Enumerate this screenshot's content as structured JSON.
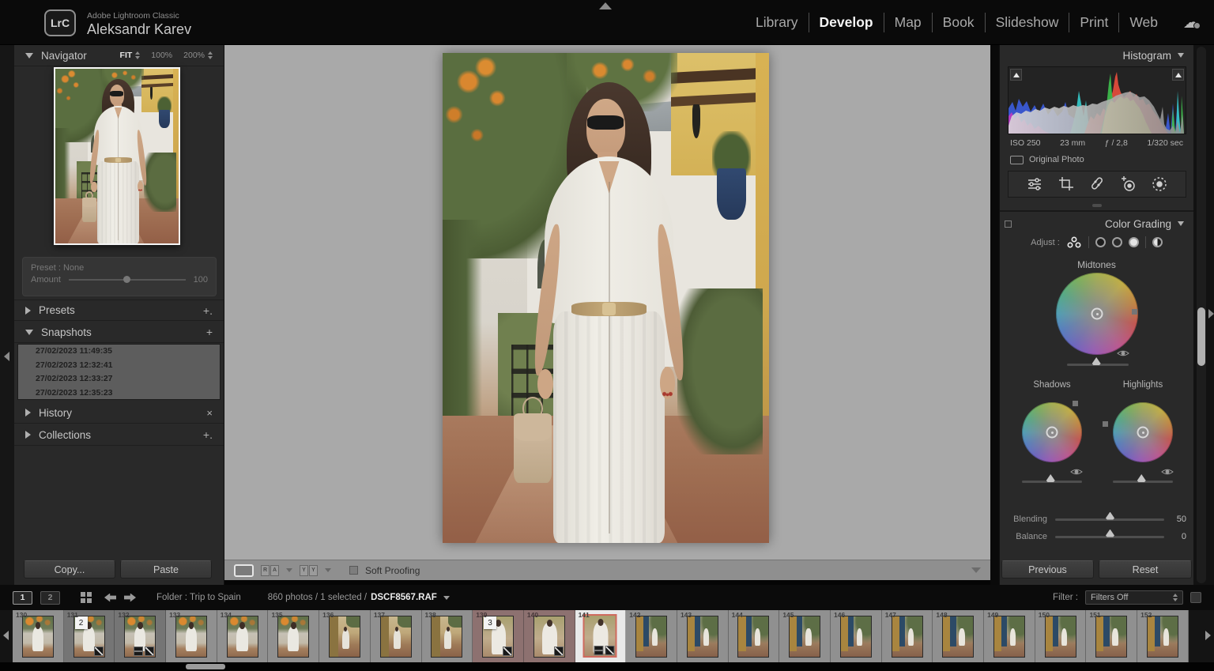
{
  "app": {
    "logo": "LrC",
    "name": "Adobe Lightroom Classic",
    "user": "Aleksandr Karev"
  },
  "top_nav": {
    "items": [
      {
        "label": "Library"
      },
      {
        "label": "Develop",
        "cls": "active"
      },
      {
        "label": "Map"
      },
      {
        "label": "Book"
      },
      {
        "label": "Slideshow"
      },
      {
        "label": "Print"
      },
      {
        "label": "Web"
      }
    ]
  },
  "left_panel": {
    "navigator": {
      "title": "Navigator",
      "fit": "FIT",
      "zoom_100": "100%",
      "zoom_200": "200%"
    },
    "preset_box": {
      "preset": "Preset : None",
      "amount_label": "Amount",
      "amount_value": "100"
    },
    "presets": {
      "title": "Presets",
      "add": "+."
    },
    "snapshots": {
      "title": "Snapshots",
      "add": "+",
      "items": [
        {
          "label": "27/02/2023 11:49:35"
        },
        {
          "label": "27/02/2023 12:32:41"
        },
        {
          "label": "27/02/2023 12:33:27"
        },
        {
          "label": "27/02/2023 12:35:23"
        }
      ]
    },
    "history": {
      "title": "History",
      "clear": "×"
    },
    "collections": {
      "title": "Collections",
      "add": "+."
    },
    "copy_button": "Copy...",
    "paste_button": "Paste"
  },
  "histogram": {
    "title": "Histogram",
    "iso": "ISO 250",
    "focal_length": "23 mm",
    "aperture": "ƒ / 2,8",
    "shutter": "1/320 sec",
    "original_photo": "Original Photo"
  },
  "color_grading": {
    "title": "Color Grading",
    "adjust_label": "Adjust :",
    "midtones": "Midtones",
    "shadows": "Shadows",
    "highlights": "Highlights",
    "blending_label": "Blending",
    "blending_value": "50",
    "balance_label": "Balance",
    "balance_value": "0"
  },
  "right_buttons": {
    "previous": "Previous",
    "reset": "Reset"
  },
  "toolbar": {
    "soft_proofing": "Soft Proofing"
  },
  "filmstrip_bar": {
    "monitor_1": "1",
    "monitor_2": "2",
    "folder": "Folder : Trip to Spain",
    "status": "860 photos / 1 selected /",
    "filename": "DSCF8567.RAF",
    "filter_label": "Filter :",
    "filter_value": "Filters Off"
  },
  "filmstrip": {
    "cells": [
      {
        "num": "130",
        "type": "garden"
      },
      {
        "num": "131",
        "type": "garden",
        "cls": "dim",
        "badge": "2",
        "adj1": true
      },
      {
        "num": "132",
        "type": "garden",
        "cls": "dim",
        "adj1": true,
        "adj2": true
      },
      {
        "num": "133",
        "type": "garden"
      },
      {
        "num": "134",
        "type": "garden"
      },
      {
        "num": "135",
        "type": "garden"
      },
      {
        "num": "136",
        "type": "street"
      },
      {
        "num": "137",
        "type": "street"
      },
      {
        "num": "138",
        "type": "street"
      },
      {
        "num": "139",
        "type": "close",
        "cls": "pink",
        "badge": "3",
        "adj1": true
      },
      {
        "num": "140",
        "type": "close",
        "cls": "pink",
        "adj1": true
      },
      {
        "num": "141",
        "type": "close",
        "cls": "sel",
        "adj1": true,
        "adj2": true
      },
      {
        "num": "142",
        "type": "door"
      },
      {
        "num": "143",
        "type": "door"
      },
      {
        "num": "144",
        "type": "door"
      },
      {
        "num": "145",
        "type": "door"
      },
      {
        "num": "146",
        "type": "door"
      },
      {
        "num": "147",
        "type": "door"
      },
      {
        "num": "148",
        "type": "door"
      },
      {
        "num": "149",
        "type": "door"
      },
      {
        "num": "150",
        "type": "door"
      },
      {
        "num": "151",
        "type": "door"
      },
      {
        "num": "152",
        "type": "door"
      }
    ]
  },
  "colors": {
    "selected_cell_border": "#cf6a5e",
    "selected_cell_bg": "#e9e9e9",
    "reject_flag_cell_bg": "#8d7170",
    "panel_bg": "#292929",
    "canvas_bg": "#a9a9a9",
    "histogram_red": "#e04c3c",
    "histogram_yellow": "#f0d83c",
    "histogram_green": "#3db84b",
    "histogram_cyan": "#35c4c4",
    "histogram_blue": "#3b5bd6",
    "histogram_magenta": "#c13bc1"
  }
}
